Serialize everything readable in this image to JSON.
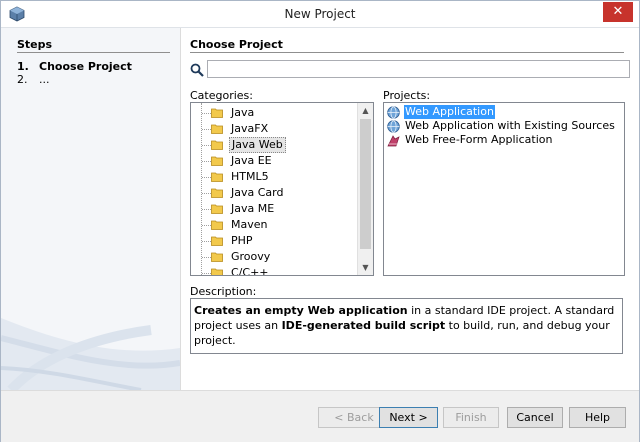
{
  "window": {
    "title": "New Project"
  },
  "steps": {
    "title": "Steps",
    "items": [
      {
        "num": "1.",
        "label": "Choose Project"
      },
      {
        "num": "2.",
        "label": "..."
      }
    ]
  },
  "main": {
    "section_title": "Choose Project",
    "search": {
      "value": "",
      "placeholder": ""
    },
    "categories_label": "Categories:",
    "projects_label": "Projects:",
    "categories": [
      "Java",
      "JavaFX",
      "Java Web",
      "Java EE",
      "HTML5",
      "Java Card",
      "Java ME",
      "Maven",
      "PHP",
      "Groovy",
      "C/C++"
    ],
    "selected_category": "Java Web",
    "projects": [
      {
        "label": "Web Application",
        "icon": "globe-icon",
        "selected": true
      },
      {
        "label": "Web Application with Existing Sources",
        "icon": "globe-icon",
        "selected": false
      },
      {
        "label": "Web Free-Form Application",
        "icon": "freeform-icon",
        "selected": false
      }
    ],
    "description_label": "Description:",
    "description": {
      "bold1": "Creates an empty Web application",
      "text1": " in a standard IDE project. A standard project uses an ",
      "bold2": "IDE-generated build script",
      "text2": " to build, run, and debug your project."
    }
  },
  "buttons": {
    "back": "< Back",
    "next": "Next >",
    "finish": "Finish",
    "cancel": "Cancel",
    "help": "Help"
  },
  "colors": {
    "selection": "#3399ff",
    "close": "#c7332c"
  }
}
